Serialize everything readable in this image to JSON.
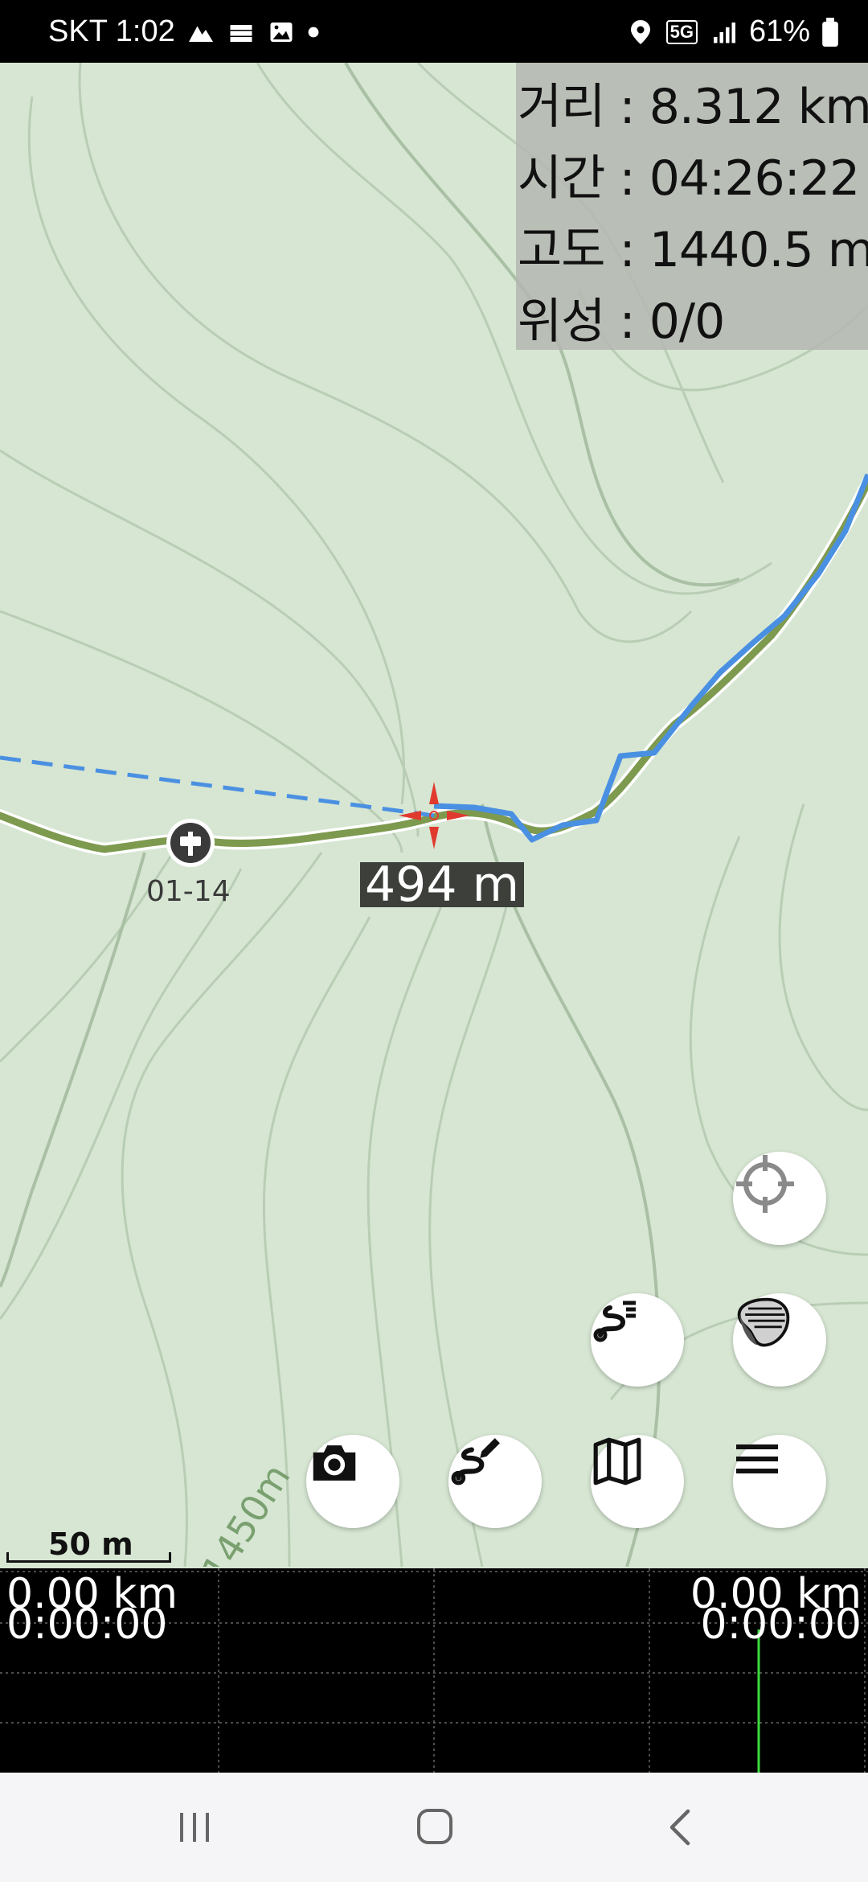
{
  "status_bar": {
    "carrier_time": "SKT 1:02",
    "battery": "61%",
    "network": "5G"
  },
  "info_panel": {
    "distance": "거리 : 8.312 km",
    "time": "시간 : 04:26:22",
    "altitude": "고도 : 1440.5 m",
    "satellites": "위성 : 0/0"
  },
  "map": {
    "distance_to_target": "494 m",
    "waypoint_label": "01-14",
    "contour_label": "1450m",
    "scale_label": "50 m"
  },
  "buttons": {
    "locate": "crosshair-icon",
    "route_list": "route-list-icon",
    "layers": "layers-icon",
    "camera": "camera-icon",
    "draw_route": "draw-route-icon",
    "map": "map-icon",
    "menu": "menu-icon"
  },
  "profile": {
    "left_distance": "0.00 km",
    "left_time": "0:00:00",
    "right_distance": "0.00 km",
    "right_time": "0:00:00"
  },
  "colors": {
    "map_bg": "#d6e6d2",
    "track_blue": "#4a90e2",
    "trail_green": "#7d9a4f",
    "target_red": "#e03a2f"
  }
}
